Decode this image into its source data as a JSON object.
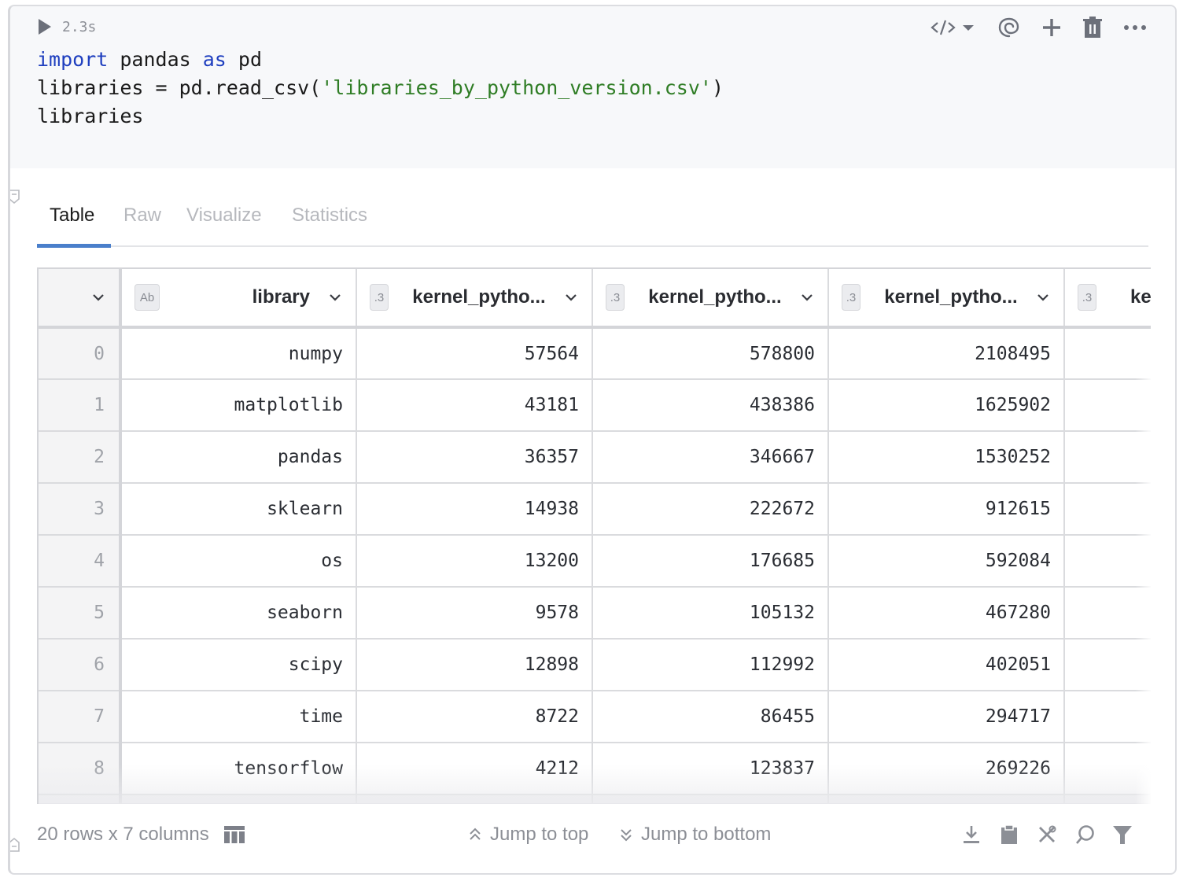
{
  "cell": {
    "execution_time": "2.3s",
    "code_lines": [
      [
        {
          "t": "import",
          "c": "kw"
        },
        {
          "t": " pandas ",
          "c": ""
        },
        {
          "t": "as",
          "c": "kw"
        },
        {
          "t": " pd",
          "c": ""
        }
      ],
      [
        {
          "t": "libraries = pd.read_csv(",
          "c": ""
        },
        {
          "t": "'libraries_by_python_version.csv'",
          "c": "str"
        },
        {
          "t": ")",
          "c": ""
        }
      ],
      [
        {
          "t": "libraries",
          "c": ""
        }
      ]
    ],
    "toolbar": [
      "code-view-icon",
      "ai-assistant-icon",
      "add-cell-icon",
      "delete-icon",
      "more-icon"
    ]
  },
  "output": {
    "tabs": [
      {
        "label": "Table",
        "active": true
      },
      {
        "label": "Raw",
        "active": false
      },
      {
        "label": "Visualize",
        "active": false
      },
      {
        "label": "Statistics",
        "active": false
      }
    ],
    "table": {
      "columns": [
        {
          "label": "library",
          "type_badge": "Ab"
        },
        {
          "label": "kernel_pytho...",
          "type_badge": ".3"
        },
        {
          "label": "kernel_pytho...",
          "type_badge": ".3"
        },
        {
          "label": "kernel_pytho...",
          "type_badge": ".3"
        },
        {
          "label": "kerne",
          "type_badge": ".3"
        }
      ],
      "rows": [
        {
          "index": "0",
          "values": [
            "numpy",
            "57564",
            "578800",
            "2108495",
            ""
          ]
        },
        {
          "index": "1",
          "values": [
            "matplotlib",
            "43181",
            "438386",
            "1625902",
            ""
          ]
        },
        {
          "index": "2",
          "values": [
            "pandas",
            "36357",
            "346667",
            "1530252",
            ""
          ]
        },
        {
          "index": "3",
          "values": [
            "sklearn",
            "14938",
            "222672",
            "912615",
            ""
          ]
        },
        {
          "index": "4",
          "values": [
            "os",
            "13200",
            "176685",
            "592084",
            ""
          ]
        },
        {
          "index": "5",
          "values": [
            "seaborn",
            "9578",
            "105132",
            "467280",
            ""
          ]
        },
        {
          "index": "6",
          "values": [
            "scipy",
            "12898",
            "112992",
            "402051",
            ""
          ]
        },
        {
          "index": "7",
          "values": [
            "time",
            "8722",
            "86455",
            "294717",
            ""
          ]
        },
        {
          "index": "8",
          "values": [
            "tensorflow",
            "4212",
            "123837",
            "269226",
            ""
          ]
        }
      ]
    },
    "footer": {
      "shape": "20 rows x 7 columns",
      "jump_top": "Jump to top",
      "jump_bottom": "Jump to bottom",
      "icons": [
        "download-icon",
        "copy-clipboard-icon",
        "settings-tools-icon",
        "search-icon",
        "filter-icon"
      ]
    }
  },
  "colors": {
    "keyword": "#1f3fbf",
    "string": "#2f7d25",
    "active_tab": "#4a7fcb",
    "icon_gray": "#6c707a"
  }
}
